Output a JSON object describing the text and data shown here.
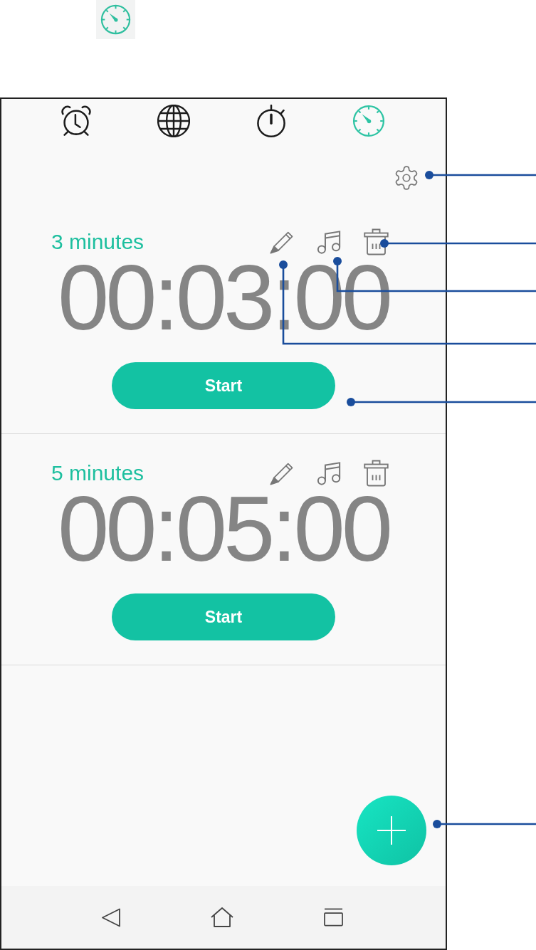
{
  "tabs": [
    {
      "kind": "alarm",
      "selected": false
    },
    {
      "kind": "world_clock",
      "selected": false
    },
    {
      "kind": "stopwatch",
      "selected": false
    },
    {
      "kind": "timer",
      "selected": true
    }
  ],
  "timers": [
    {
      "label": "3 minutes",
      "time": "00:03:00",
      "button": "Start"
    },
    {
      "label": "5 minutes",
      "time": "00:05:00",
      "button": "Start"
    }
  ]
}
